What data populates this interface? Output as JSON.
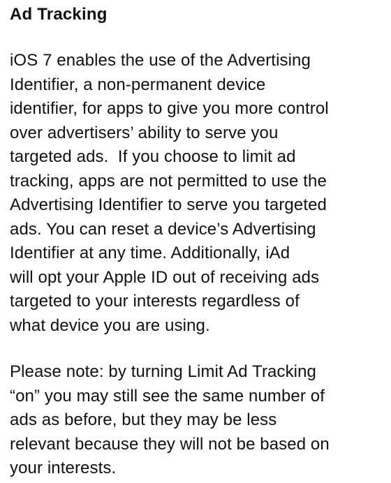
{
  "document": {
    "title": "Ad Tracking",
    "paragraphs": [
      {
        "lines": [
          "iOS 7 enables the use of the Advertising",
          "Identifier, a non-permanent device",
          "identifier, for apps to give you more control",
          "over advertisers’ ability to serve you",
          "targeted ads.  If you choose to limit ad",
          "tracking, apps are not permitted to use the",
          "Advertising Identifier to serve you targeted",
          "ads. You can reset a device’s Advertising",
          "Identifier at any time. Additionally, iAd",
          "will opt your Apple ID out of receiving ads",
          "targeted to your interests regardless of",
          "what device you are using."
        ]
      },
      {
        "lines": [
          "Please note: by turning Limit Ad Tracking",
          "“on” you may still see the same number of",
          "ads as before, but they may be less",
          "relevant because they will not be based on",
          "your interests."
        ]
      }
    ]
  }
}
